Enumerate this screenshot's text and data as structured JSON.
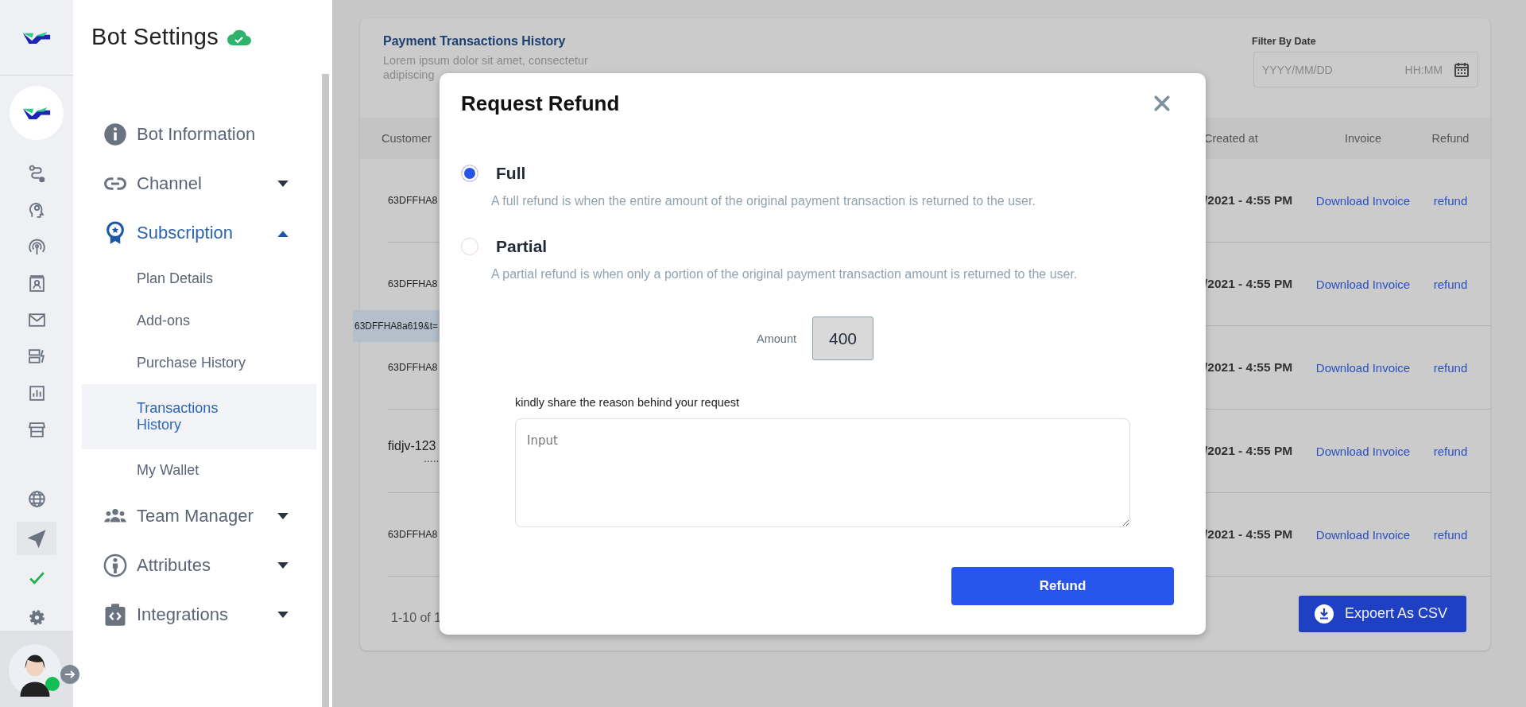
{
  "sidebar": {
    "title": "Bot Settings",
    "items": [
      {
        "label": "Bot Information",
        "kind": "link"
      },
      {
        "label": "Channel",
        "kind": "group",
        "expanded": false
      },
      {
        "label": "Subscription",
        "kind": "group",
        "expanded": true,
        "children": [
          {
            "label": "Plan Details",
            "selected": false
          },
          {
            "label": "Add-ons",
            "selected": false
          },
          {
            "label": "Purchase History",
            "selected": false
          },
          {
            "label": "Transactions History",
            "selected": true
          },
          {
            "label": "My Wallet",
            "selected": false
          }
        ]
      },
      {
        "label": "Team Manager",
        "kind": "group",
        "expanded": false
      },
      {
        "label": "Attributes",
        "kind": "group",
        "expanded": false
      },
      {
        "label": "Integrations",
        "kind": "group",
        "expanded": false
      }
    ]
  },
  "card": {
    "title": "Payment Transactions History",
    "subtitle": "Lorem ipsum dolor sit amet, consectetur adipiscing",
    "filter": {
      "label": "Filter By Date",
      "date_placeholder": "YYYY/MM/DD",
      "time_placeholder": "HH:MM"
    },
    "table": {
      "columns": [
        "Customer",
        "Created at",
        "Invoice",
        "Refund"
      ],
      "rows": [
        {
          "customer": "63DFFHA8",
          "created": "/2021 - 4:55 PM",
          "invoice": "Download Invoice",
          "refund": "refund"
        },
        {
          "customer": "63DFFHA8",
          "created": "/2021 - 4:55 PM",
          "invoice": "Download Invoice",
          "refund": "refund"
        },
        {
          "customer": "63DFFHA8",
          "created": "/2021 - 4:55 PM",
          "invoice": "Download Invoice",
          "refund": "refund"
        },
        {
          "customer": "fidjv-123",
          "customer_more": ".....",
          "created": "/2021 - 4:55 PM",
          "invoice": "Download Invoice",
          "refund": "refund"
        },
        {
          "customer": "63DFFHA8",
          "created": "/2021 - 4:55 PM",
          "invoice": "Download Invoice",
          "refund": "refund"
        }
      ],
      "tooltip": "63DFFHA8a619&t="
    },
    "pagination": "1-10 of 1",
    "export": "Expoert As CSV"
  },
  "modal": {
    "title": "Request Refund",
    "options": [
      {
        "label": "Full",
        "description": "A full refund is when the entire amount of the original payment transaction is returned to the user.",
        "selected": true
      },
      {
        "label": "Partial",
        "description": "A partial refund is when only a portion of the original payment transaction amount is returned to the user.",
        "selected": false
      }
    ],
    "amount_label": "Amount",
    "amount": "400",
    "reason_label": "kindly share the reason behind your request",
    "reason_placeholder": "Input",
    "submit": "Refund"
  }
}
